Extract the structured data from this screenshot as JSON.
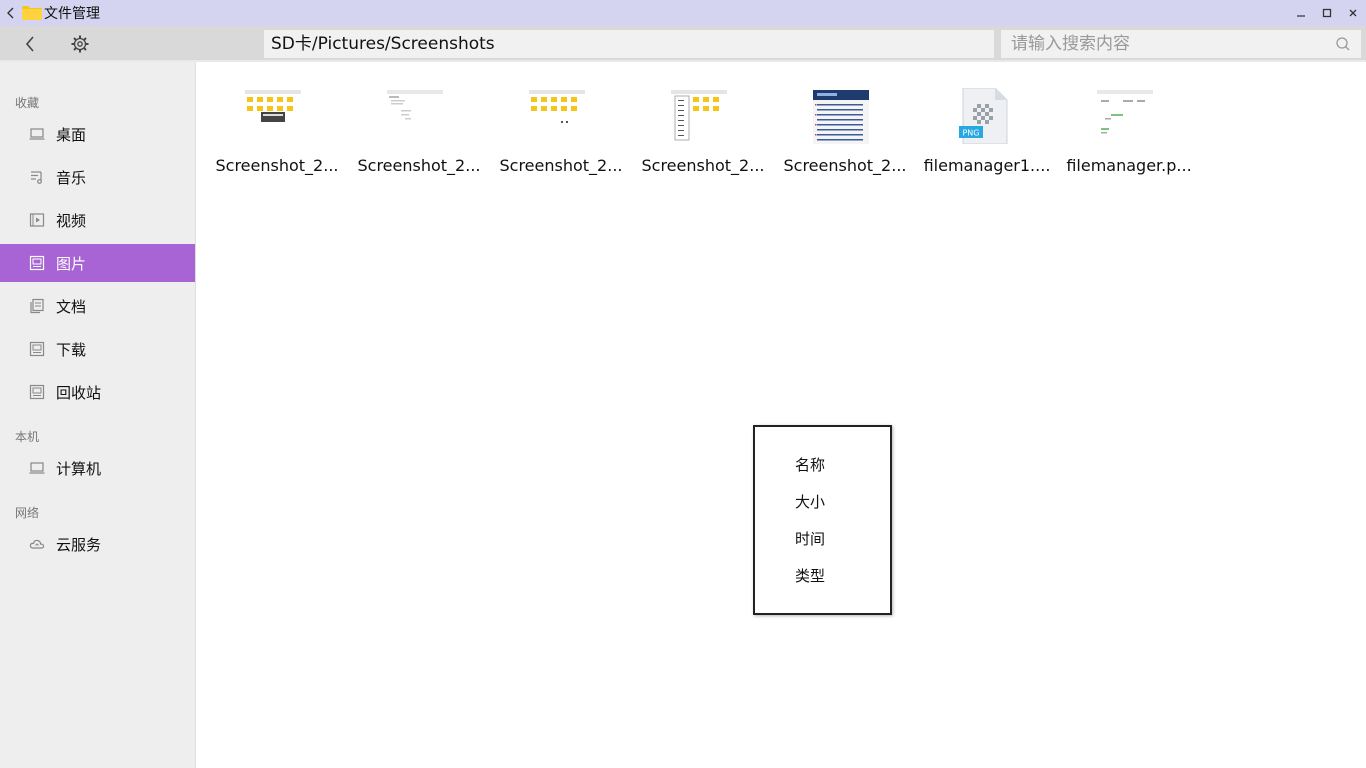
{
  "window": {
    "title": "文件管理"
  },
  "toolbar": {
    "path": "SD卡/Pictures/Screenshots",
    "search_placeholder": "请输入搜索内容"
  },
  "sidebar": {
    "sections": [
      {
        "label": "收藏"
      },
      {
        "label": "本机"
      },
      {
        "label": "网络"
      }
    ],
    "items": [
      {
        "label": "桌面",
        "icon": "desktop-icon"
      },
      {
        "label": "音乐",
        "icon": "music-icon"
      },
      {
        "label": "视频",
        "icon": "video-icon"
      },
      {
        "label": "图片",
        "icon": "picture-icon",
        "active": true
      },
      {
        "label": "文档",
        "icon": "document-icon"
      },
      {
        "label": "下载",
        "icon": "download-icon"
      },
      {
        "label": "回收站",
        "icon": "trash-icon"
      },
      {
        "label": "计算机",
        "icon": "computer-icon"
      },
      {
        "label": "云服务",
        "icon": "cloud-icon"
      }
    ]
  },
  "files": [
    {
      "name": "Screenshot_2...",
      "thumb": "screenshot-thumbnail"
    },
    {
      "name": "Screenshot_2...",
      "thumb": "screenshot-thumbnail"
    },
    {
      "name": "Screenshot_2...",
      "thumb": "screenshot-thumbnail"
    },
    {
      "name": "Screenshot_2...",
      "thumb": "screenshot-thumbnail"
    },
    {
      "name": "Screenshot_2...",
      "thumb": "screenshot-thumbnail"
    },
    {
      "name": "filemanager1....",
      "thumb": "png-file-icon",
      "badge": "PNG"
    },
    {
      "name": "filemanager.p...",
      "thumb": "screenshot-thumbnail"
    }
  ],
  "sort_menu": {
    "items": [
      "名称",
      "大小",
      "时间",
      "类型"
    ]
  },
  "colors": {
    "titlebar": "#d4d4f0",
    "active_item": "#a864d4",
    "folder": "#f5c518"
  }
}
